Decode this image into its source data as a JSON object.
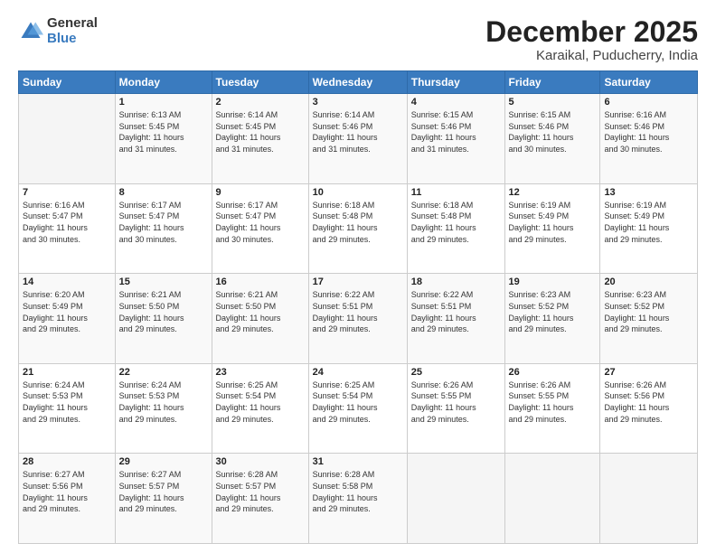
{
  "logo": {
    "general": "General",
    "blue": "Blue"
  },
  "header": {
    "month": "December 2025",
    "location": "Karaikal, Puducherry, India"
  },
  "days_header": [
    "Sunday",
    "Monday",
    "Tuesday",
    "Wednesday",
    "Thursday",
    "Friday",
    "Saturday"
  ],
  "weeks": [
    [
      {
        "day": "",
        "sunrise": "",
        "sunset": "",
        "daylight": ""
      },
      {
        "day": "1",
        "sunrise": "Sunrise: 6:13 AM",
        "sunset": "Sunset: 5:45 PM",
        "daylight": "Daylight: 11 hours and 31 minutes."
      },
      {
        "day": "2",
        "sunrise": "Sunrise: 6:14 AM",
        "sunset": "Sunset: 5:45 PM",
        "daylight": "Daylight: 11 hours and 31 minutes."
      },
      {
        "day": "3",
        "sunrise": "Sunrise: 6:14 AM",
        "sunset": "Sunset: 5:46 PM",
        "daylight": "Daylight: 11 hours and 31 minutes."
      },
      {
        "day": "4",
        "sunrise": "Sunrise: 6:15 AM",
        "sunset": "Sunset: 5:46 PM",
        "daylight": "Daylight: 11 hours and 31 minutes."
      },
      {
        "day": "5",
        "sunrise": "Sunrise: 6:15 AM",
        "sunset": "Sunset: 5:46 PM",
        "daylight": "Daylight: 11 hours and 30 minutes."
      },
      {
        "day": "6",
        "sunrise": "Sunrise: 6:16 AM",
        "sunset": "Sunset: 5:46 PM",
        "daylight": "Daylight: 11 hours and 30 minutes."
      }
    ],
    [
      {
        "day": "7",
        "sunrise": "Sunrise: 6:16 AM",
        "sunset": "Sunset: 5:47 PM",
        "daylight": "Daylight: 11 hours and 30 minutes."
      },
      {
        "day": "8",
        "sunrise": "Sunrise: 6:17 AM",
        "sunset": "Sunset: 5:47 PM",
        "daylight": "Daylight: 11 hours and 30 minutes."
      },
      {
        "day": "9",
        "sunrise": "Sunrise: 6:17 AM",
        "sunset": "Sunset: 5:47 PM",
        "daylight": "Daylight: 11 hours and 30 minutes."
      },
      {
        "day": "10",
        "sunrise": "Sunrise: 6:18 AM",
        "sunset": "Sunset: 5:48 PM",
        "daylight": "Daylight: 11 hours and 29 minutes."
      },
      {
        "day": "11",
        "sunrise": "Sunrise: 6:18 AM",
        "sunset": "Sunset: 5:48 PM",
        "daylight": "Daylight: 11 hours and 29 minutes."
      },
      {
        "day": "12",
        "sunrise": "Sunrise: 6:19 AM",
        "sunset": "Sunset: 5:49 PM",
        "daylight": "Daylight: 11 hours and 29 minutes."
      },
      {
        "day": "13",
        "sunrise": "Sunrise: 6:19 AM",
        "sunset": "Sunset: 5:49 PM",
        "daylight": "Daylight: 11 hours and 29 minutes."
      }
    ],
    [
      {
        "day": "14",
        "sunrise": "Sunrise: 6:20 AM",
        "sunset": "Sunset: 5:49 PM",
        "daylight": "Daylight: 11 hours and 29 minutes."
      },
      {
        "day": "15",
        "sunrise": "Sunrise: 6:21 AM",
        "sunset": "Sunset: 5:50 PM",
        "daylight": "Daylight: 11 hours and 29 minutes."
      },
      {
        "day": "16",
        "sunrise": "Sunrise: 6:21 AM",
        "sunset": "Sunset: 5:50 PM",
        "daylight": "Daylight: 11 hours and 29 minutes."
      },
      {
        "day": "17",
        "sunrise": "Sunrise: 6:22 AM",
        "sunset": "Sunset: 5:51 PM",
        "daylight": "Daylight: 11 hours and 29 minutes."
      },
      {
        "day": "18",
        "sunrise": "Sunrise: 6:22 AM",
        "sunset": "Sunset: 5:51 PM",
        "daylight": "Daylight: 11 hours and 29 minutes."
      },
      {
        "day": "19",
        "sunrise": "Sunrise: 6:23 AM",
        "sunset": "Sunset: 5:52 PM",
        "daylight": "Daylight: 11 hours and 29 minutes."
      },
      {
        "day": "20",
        "sunrise": "Sunrise: 6:23 AM",
        "sunset": "Sunset: 5:52 PM",
        "daylight": "Daylight: 11 hours and 29 minutes."
      }
    ],
    [
      {
        "day": "21",
        "sunrise": "Sunrise: 6:24 AM",
        "sunset": "Sunset: 5:53 PM",
        "daylight": "Daylight: 11 hours and 29 minutes."
      },
      {
        "day": "22",
        "sunrise": "Sunrise: 6:24 AM",
        "sunset": "Sunset: 5:53 PM",
        "daylight": "Daylight: 11 hours and 29 minutes."
      },
      {
        "day": "23",
        "sunrise": "Sunrise: 6:25 AM",
        "sunset": "Sunset: 5:54 PM",
        "daylight": "Daylight: 11 hours and 29 minutes."
      },
      {
        "day": "24",
        "sunrise": "Sunrise: 6:25 AM",
        "sunset": "Sunset: 5:54 PM",
        "daylight": "Daylight: 11 hours and 29 minutes."
      },
      {
        "day": "25",
        "sunrise": "Sunrise: 6:26 AM",
        "sunset": "Sunset: 5:55 PM",
        "daylight": "Daylight: 11 hours and 29 minutes."
      },
      {
        "day": "26",
        "sunrise": "Sunrise: 6:26 AM",
        "sunset": "Sunset: 5:55 PM",
        "daylight": "Daylight: 11 hours and 29 minutes."
      },
      {
        "day": "27",
        "sunrise": "Sunrise: 6:26 AM",
        "sunset": "Sunset: 5:56 PM",
        "daylight": "Daylight: 11 hours and 29 minutes."
      }
    ],
    [
      {
        "day": "28",
        "sunrise": "Sunrise: 6:27 AM",
        "sunset": "Sunset: 5:56 PM",
        "daylight": "Daylight: 11 hours and 29 minutes."
      },
      {
        "day": "29",
        "sunrise": "Sunrise: 6:27 AM",
        "sunset": "Sunset: 5:57 PM",
        "daylight": "Daylight: 11 hours and 29 minutes."
      },
      {
        "day": "30",
        "sunrise": "Sunrise: 6:28 AM",
        "sunset": "Sunset: 5:57 PM",
        "daylight": "Daylight: 11 hours and 29 minutes."
      },
      {
        "day": "31",
        "sunrise": "Sunrise: 6:28 AM",
        "sunset": "Sunset: 5:58 PM",
        "daylight": "Daylight: 11 hours and 29 minutes."
      },
      {
        "day": "",
        "sunrise": "",
        "sunset": "",
        "daylight": ""
      },
      {
        "day": "",
        "sunrise": "",
        "sunset": "",
        "daylight": ""
      },
      {
        "day": "",
        "sunrise": "",
        "sunset": "",
        "daylight": ""
      }
    ]
  ]
}
